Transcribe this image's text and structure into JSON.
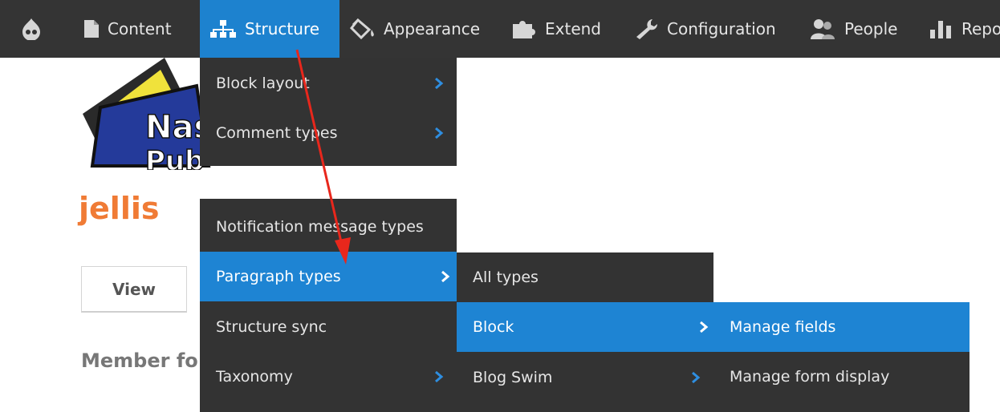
{
  "toolbar": {
    "items": [
      {
        "label": "",
        "icon": "drupal-drop-icon"
      },
      {
        "label": "Content",
        "icon": "page-icon"
      },
      {
        "label": "Structure",
        "icon": "sitemap-icon"
      },
      {
        "label": "Appearance",
        "icon": "paint-bucket-icon"
      },
      {
        "label": "Extend",
        "icon": "puzzle-icon"
      },
      {
        "label": "Configuration",
        "icon": "wrench-icon"
      },
      {
        "label": "People",
        "icon": "people-icon"
      },
      {
        "label": "Repo",
        "icon": "bar-chart-icon"
      }
    ]
  },
  "page": {
    "logo_text_1": "Nas",
    "logo_text_2": "Pub",
    "username": "jellis",
    "tab_view": "View",
    "member_for": "Member fo"
  },
  "structure_menu": {
    "items": [
      "Block layout",
      "Comment types",
      "Notification message types",
      "Paragraph types",
      "Structure sync",
      "Taxonomy"
    ]
  },
  "paragraph_types_menu": {
    "items": [
      "All types",
      "Block",
      "Blog Swim"
    ]
  },
  "block_menu": {
    "items": [
      "Manage fields",
      "Manage form display"
    ]
  },
  "colors": {
    "toolbar_bg": "#343434",
    "menu_bg": "#333333",
    "active_blue": "#1e84d3",
    "username_orange": "#f07b35",
    "annotation_arrow": "#e8271c"
  }
}
